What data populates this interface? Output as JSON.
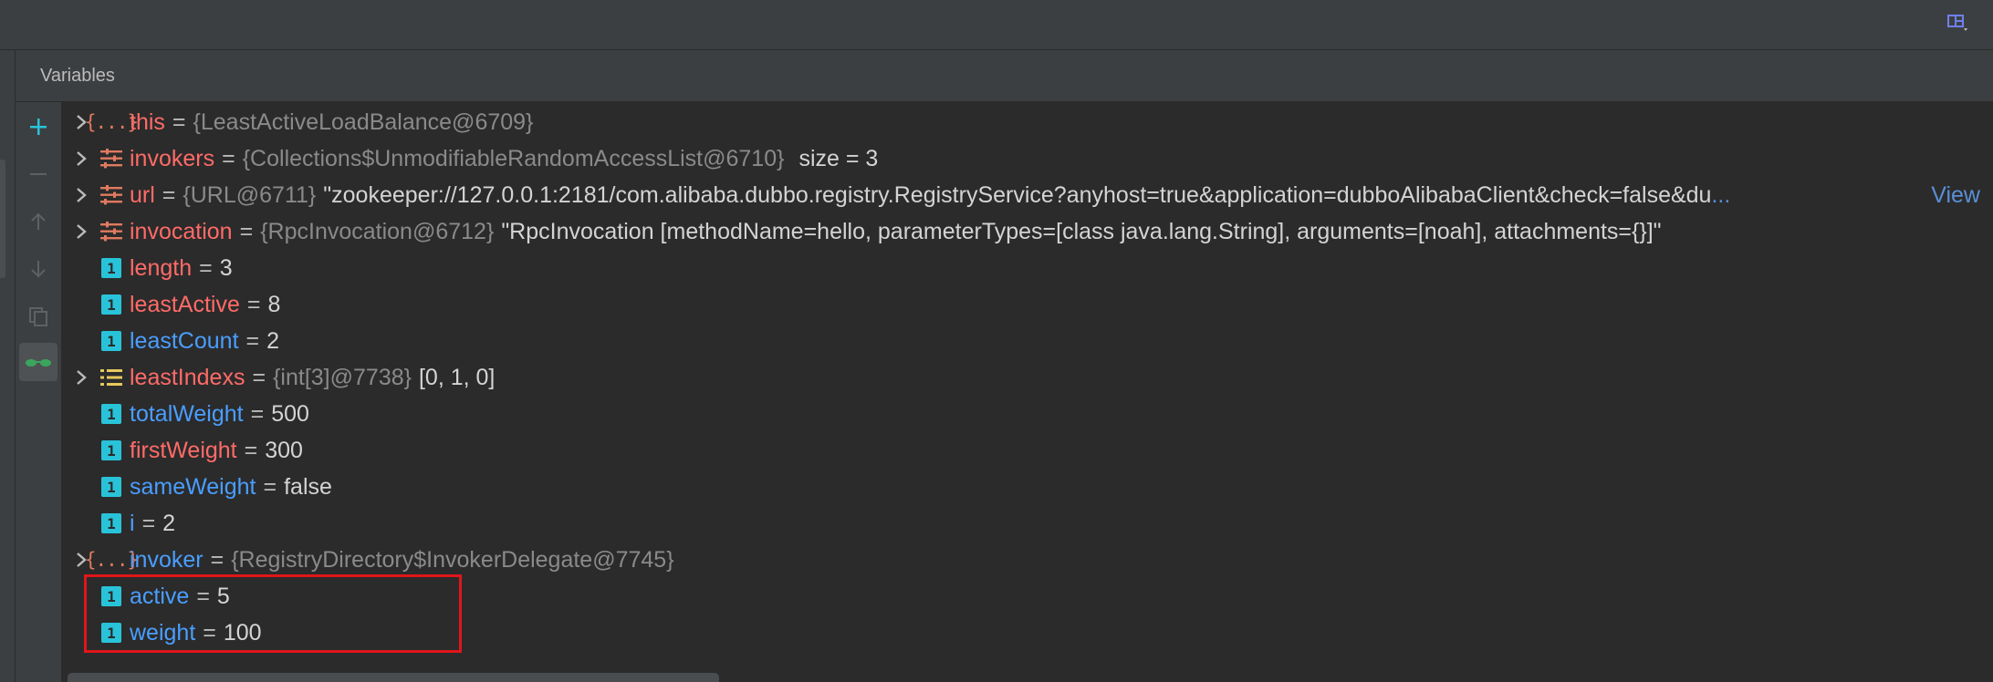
{
  "panel": {
    "title": "Variables"
  },
  "toolbar": {
    "add_icon": "plus-icon",
    "remove_icon": "minus-icon",
    "up_icon": "arrow-up-icon",
    "down_icon": "arrow-down-icon",
    "copy_icon": "copy-icon",
    "watch_icon": "glasses-icon"
  },
  "variables": [
    {
      "expandable": true,
      "icon": "object",
      "name": "this",
      "name_color": "red",
      "ref": "{LeastActiveLoadBalance@6709}",
      "value": "",
      "extra": ""
    },
    {
      "expandable": true,
      "icon": "field-list",
      "name": "invokers",
      "name_color": "red",
      "ref": "{Collections$UnmodifiableRandomAccessList@6710}",
      "value": "",
      "extra": "size = 3"
    },
    {
      "expandable": true,
      "icon": "field-list",
      "name": "url",
      "name_color": "red",
      "ref": "{URL@6711}",
      "value": "\"zookeeper://127.0.0.1:2181/com.alibaba.dubbo.registry.RegistryService?anyhost=true&application=dubboAlibabaClient&check=false&du",
      "extra": "",
      "more": "...",
      "view": "View"
    },
    {
      "expandable": true,
      "icon": "field-list",
      "name": "invocation",
      "name_color": "red",
      "ref": "{RpcInvocation@6712}",
      "value": "\"RpcInvocation [methodName=hello, parameterTypes=[class java.lang.String], arguments=[noah], attachments={}]\"",
      "extra": ""
    },
    {
      "expandable": false,
      "icon": "primitive",
      "name": "length",
      "name_color": "red",
      "ref": "",
      "value": "3",
      "extra": ""
    },
    {
      "expandable": false,
      "icon": "primitive",
      "name": "leastActive",
      "name_color": "red",
      "ref": "",
      "value": "8",
      "extra": ""
    },
    {
      "expandable": false,
      "icon": "primitive",
      "name": "leastCount",
      "name_color": "blue",
      "ref": "",
      "value": "2",
      "extra": ""
    },
    {
      "expandable": true,
      "icon": "array",
      "name": "leastIndexs",
      "name_color": "red",
      "ref": "{int[3]@7738}",
      "value": "[0, 1, 0]",
      "extra": ""
    },
    {
      "expandable": false,
      "icon": "primitive",
      "name": "totalWeight",
      "name_color": "blue",
      "ref": "",
      "value": "500",
      "extra": ""
    },
    {
      "expandable": false,
      "icon": "primitive",
      "name": "firstWeight",
      "name_color": "red",
      "ref": "",
      "value": "300",
      "extra": ""
    },
    {
      "expandable": false,
      "icon": "primitive",
      "name": "sameWeight",
      "name_color": "blue",
      "ref": "",
      "value": "false",
      "extra": ""
    },
    {
      "expandable": false,
      "icon": "primitive",
      "name": "i",
      "name_color": "blue",
      "ref": "",
      "value": "2",
      "extra": ""
    },
    {
      "expandable": true,
      "icon": "object",
      "name": "invoker",
      "name_color": "blue",
      "ref": "{RegistryDirectory$InvokerDelegate@7745}",
      "value": "",
      "extra": ""
    },
    {
      "expandable": false,
      "icon": "primitive",
      "name": "active",
      "name_color": "blue",
      "ref": "",
      "value": "5",
      "extra": ""
    },
    {
      "expandable": false,
      "icon": "primitive",
      "name": "weight",
      "name_color": "blue",
      "ref": "",
      "value": "100",
      "extra": ""
    }
  ],
  "labels": {
    "equals": "=",
    "primitive_glyph": "1",
    "object_glyph": "{...}"
  },
  "colors": {
    "background": "#2b2b2b",
    "name_red": "#ff6b68",
    "name_blue": "#4a9eff",
    "accent": "#29c3d9",
    "highlight": "#e0161a"
  }
}
